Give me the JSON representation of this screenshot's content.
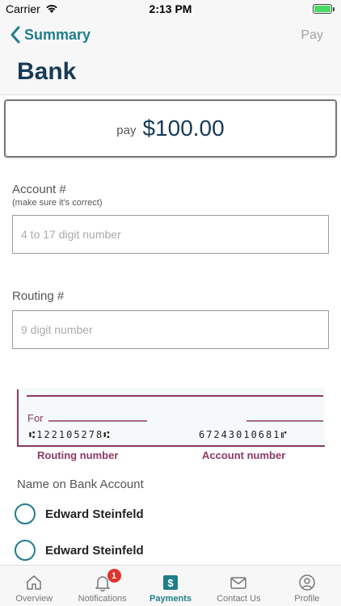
{
  "status_bar": {
    "carrier": "Carrier",
    "time": "2:13 PM"
  },
  "nav": {
    "back_label": "Summary",
    "pay_label": "Pay",
    "title": "Bank"
  },
  "amount": {
    "prefix": "pay",
    "value": "$100.00"
  },
  "account_field": {
    "label": "Account #",
    "hint": "(make sure it's correct)",
    "placeholder": "4 to 17 digit number",
    "value": ""
  },
  "routing_field": {
    "label": "Routing #",
    "placeholder": "9 digit number",
    "value": ""
  },
  "check": {
    "for_label": "For",
    "routing_digits": "⑆122105278⑆",
    "account_digits": "67243010681⑈",
    "routing_caption": "Routing number",
    "account_caption": "Account number"
  },
  "name_section": {
    "label": "Name on Bank Account",
    "options": [
      {
        "name": "Edward Steinfeld",
        "selected": false
      },
      {
        "name": "Edward Steinfeld",
        "selected": false
      }
    ]
  },
  "tabs": [
    {
      "label": "Overview",
      "icon": "home-icon",
      "active": false
    },
    {
      "label": "Notifications",
      "icon": "bell-icon",
      "active": false,
      "badge": "1"
    },
    {
      "label": "Payments",
      "icon": "dollar-icon",
      "active": true
    },
    {
      "label": "Contact Us",
      "icon": "envelope-icon",
      "active": false
    },
    {
      "label": "Profile",
      "icon": "user-icon",
      "active": false
    }
  ],
  "colors": {
    "accent": "#1f7e8a",
    "title": "#173b57",
    "check_caption": "#8a3b64",
    "badge": "#e0342d"
  }
}
